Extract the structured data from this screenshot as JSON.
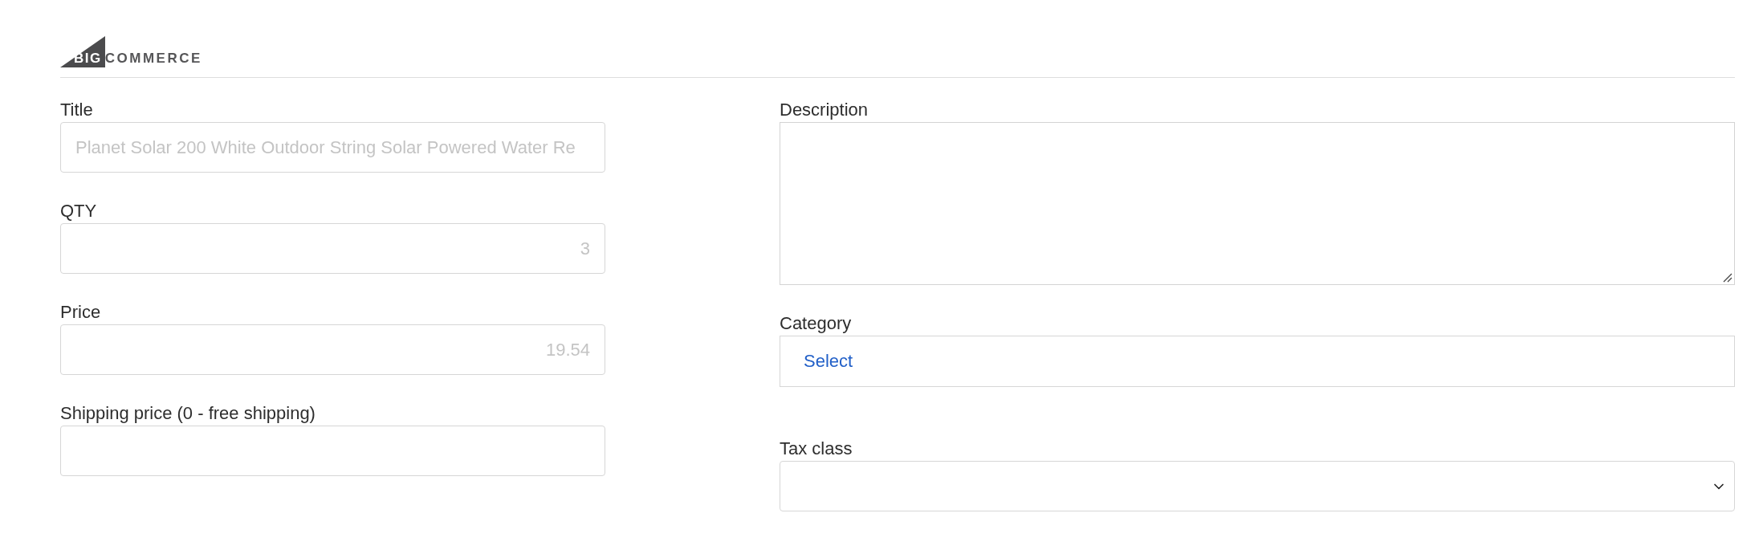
{
  "logo": {
    "mark_text": "BIG",
    "wordmark": "COMMERCE"
  },
  "left_fields": [
    {
      "label": "Title",
      "kind": "text",
      "placeholder": "Planet Solar 200 White Outdoor String Solar Powered Water Re"
    },
    {
      "label": "QTY",
      "kind": "number",
      "placeholder": "3"
    },
    {
      "label": "Price",
      "kind": "number",
      "placeholder": "19.54"
    },
    {
      "label": "Shipping price (0 - free shipping)",
      "kind": "number"
    }
  ],
  "right_fields": [
    {
      "label": "Description",
      "kind": "textarea"
    },
    {
      "label": "Category",
      "kind": "picker",
      "link": "Select"
    },
    {
      "label": "Tax class",
      "kind": "select"
    }
  ]
}
